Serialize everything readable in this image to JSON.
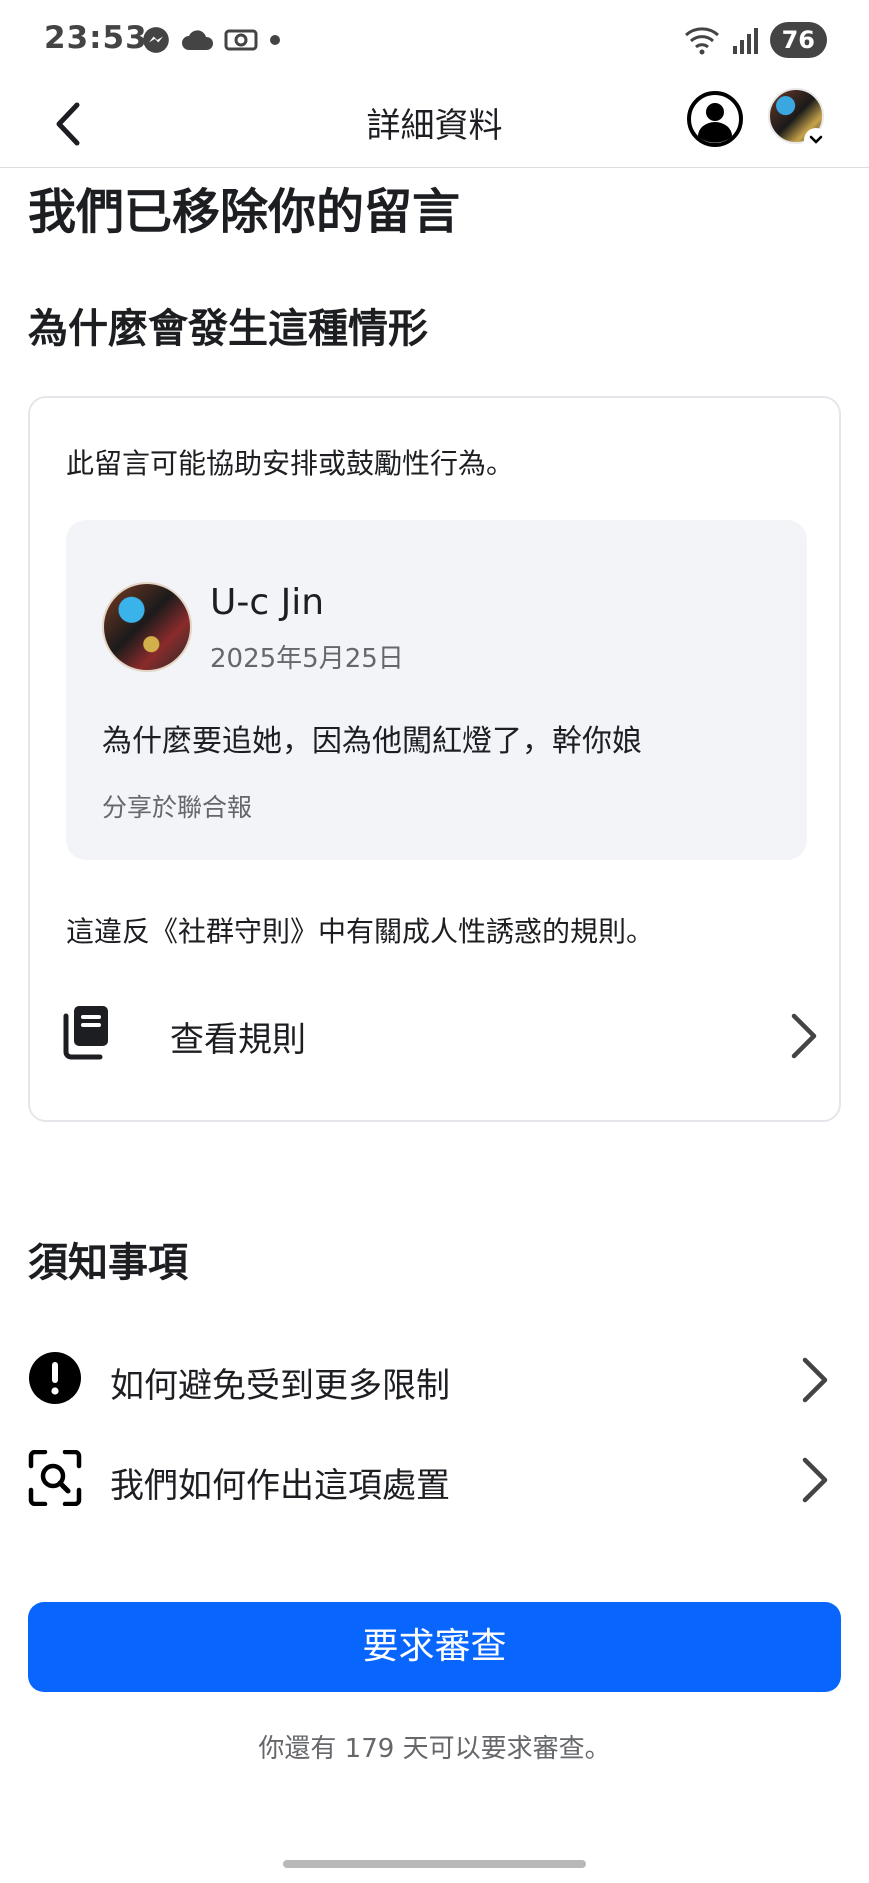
{
  "status_bar": {
    "time": "23:53",
    "battery": "76",
    "left_icons": [
      "messenger-icon",
      "cloud-icon",
      "camera-icon",
      "dot-icon"
    ],
    "right_icons": [
      "wifi-icon",
      "signal-icon"
    ]
  },
  "header": {
    "title": "詳細資料",
    "back_icon": "chevron-left-icon",
    "profile_icon": "account-circle-icon"
  },
  "main": {
    "title": "我們已移除你的留言",
    "why_heading": "為什麼會發生這種情形",
    "card": {
      "description": "此留言可能協助安排或鼓勵性行為。",
      "comment": {
        "author": "U-c Jin",
        "date": "2025年5月25日",
        "text": "為什麼要追她，因為他闖紅燈了，幹你娘",
        "shared_on": "分享於聯合報"
      },
      "violation": "這違反《社群守則》中有關成人性誘惑的規則。",
      "view_rules": "查看規則"
    },
    "notes_heading": "須知事項",
    "notes": [
      {
        "label": "如何避免受到更多限制",
        "icon": "alert-circle-icon"
      },
      {
        "label": "我們如何作出這項處置",
        "icon": "scan-search-icon"
      }
    ],
    "request_review_button": "要求審查",
    "footnote": "你還有 179 天可以要求審查。"
  },
  "colors": {
    "primary": "#0866ff",
    "text": "#1c1e21",
    "secondary_text": "#65676b",
    "card_bg": "#f2f4f7"
  }
}
